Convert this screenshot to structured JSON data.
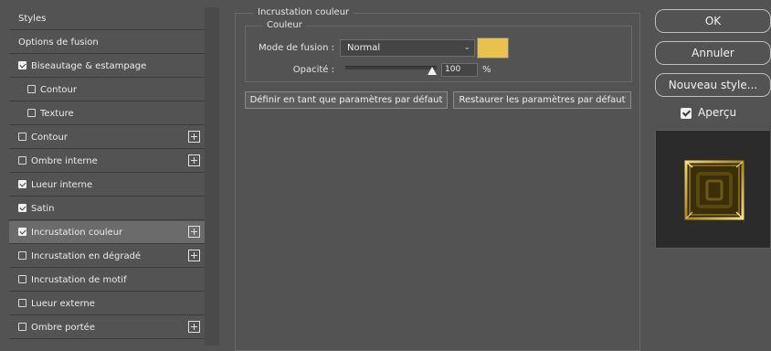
{
  "sidebar": {
    "items": [
      {
        "label": "Styles",
        "checkbox": false,
        "checked": false,
        "plus": false,
        "indent": false,
        "selected": false
      },
      {
        "label": "Options de fusion",
        "checkbox": false,
        "checked": false,
        "plus": false,
        "indent": false,
        "selected": false
      },
      {
        "label": "Biseautage & estampage",
        "checkbox": true,
        "checked": true,
        "plus": false,
        "indent": false,
        "selected": false
      },
      {
        "label": "Contour",
        "checkbox": true,
        "checked": false,
        "plus": false,
        "indent": true,
        "selected": false
      },
      {
        "label": "Texture",
        "checkbox": true,
        "checked": false,
        "plus": false,
        "indent": true,
        "selected": false
      },
      {
        "label": "Contour",
        "checkbox": true,
        "checked": false,
        "plus": true,
        "indent": false,
        "selected": false
      },
      {
        "label": "Ombre interne",
        "checkbox": true,
        "checked": false,
        "plus": true,
        "indent": false,
        "selected": false
      },
      {
        "label": "Lueur interne",
        "checkbox": true,
        "checked": true,
        "plus": false,
        "indent": false,
        "selected": false
      },
      {
        "label": "Satin",
        "checkbox": true,
        "checked": true,
        "plus": false,
        "indent": false,
        "selected": false
      },
      {
        "label": "Incrustation couleur",
        "checkbox": true,
        "checked": true,
        "plus": true,
        "indent": false,
        "selected": true
      },
      {
        "label": "Incrustation en dégradé",
        "checkbox": true,
        "checked": false,
        "plus": true,
        "indent": false,
        "selected": false
      },
      {
        "label": "Incrustation de motif",
        "checkbox": true,
        "checked": false,
        "plus": false,
        "indent": false,
        "selected": false
      },
      {
        "label": "Lueur externe",
        "checkbox": true,
        "checked": false,
        "plus": false,
        "indent": false,
        "selected": false
      },
      {
        "label": "Ombre portée",
        "checkbox": true,
        "checked": false,
        "plus": true,
        "indent": false,
        "selected": false
      }
    ]
  },
  "panel": {
    "title": "Incrustation couleur",
    "section": "Couleur",
    "blend_label": "Mode de fusion :",
    "blend_value": "Normal",
    "color_hex": "#e8c14e",
    "opacity_label": "Opacité :",
    "opacity_value": "100",
    "opacity_unit": "%",
    "opacity_level": 0.95,
    "default_button": "Définir en tant que paramètres par défaut",
    "reset_button": "Restaurer les paramètres par défaut"
  },
  "actions": {
    "ok": "OK",
    "cancel": "Annuler",
    "new_style": "Nouveau style...",
    "preview_label": "Aperçu",
    "preview_checked": true
  },
  "colors": {
    "gold": "#e8c14e",
    "gold_dark": "#3b2f0a",
    "selected_row": "#6b6b6b"
  }
}
